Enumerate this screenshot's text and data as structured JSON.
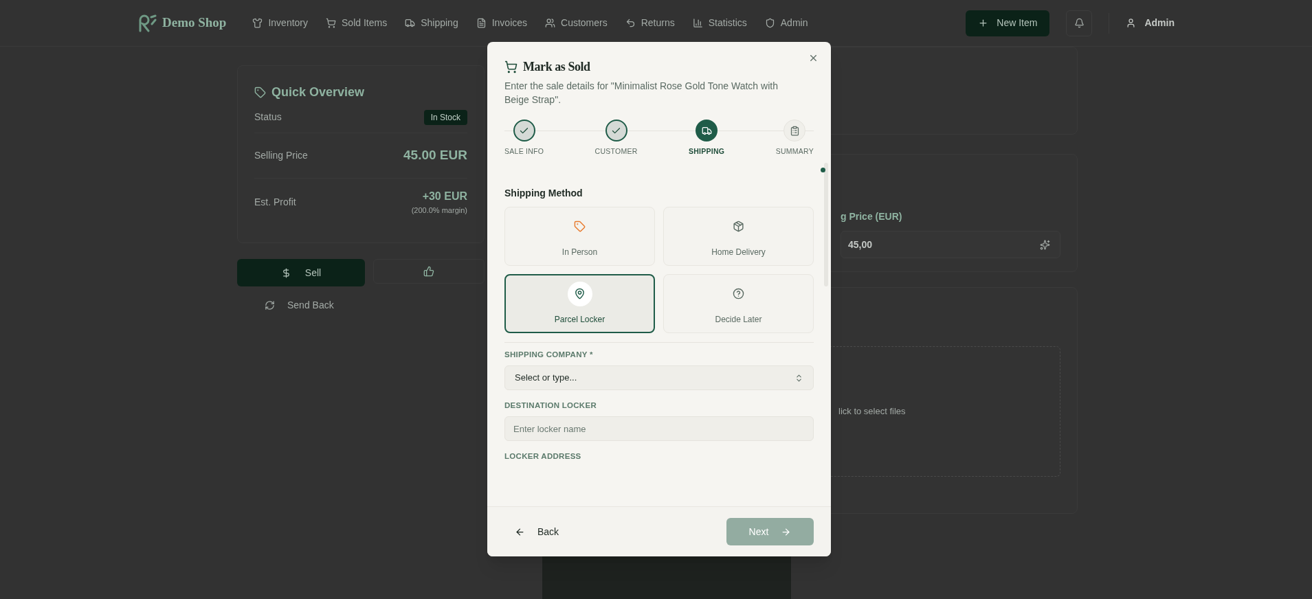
{
  "nav": {
    "brand": "Demo Shop",
    "items": [
      {
        "label": "Inventory",
        "selected": false
      },
      {
        "label": "Sold Items",
        "selected": false
      },
      {
        "label": "Shipping",
        "selected": false
      },
      {
        "label": "Invoices",
        "selected": false
      },
      {
        "label": "Customers",
        "selected": false
      },
      {
        "label": "Returns",
        "selected": false
      },
      {
        "label": "Statistics",
        "selected": false
      },
      {
        "label": "Admin",
        "selected": false
      }
    ],
    "new_item_button": "New Item",
    "user": "Admin"
  },
  "overview": {
    "title": "Quick Overview",
    "status_label": "Status",
    "status_badge": "In Stock",
    "price_label": "Selling Price",
    "price": "45.00 EUR",
    "profit_label": "Est. Profit",
    "profit": "+30 EUR",
    "margin": "(200.0% margin)"
  },
  "actions": {
    "sell": "Sell",
    "send_back": "Send Back"
  },
  "price_card": {
    "label": "g Price (EUR)",
    "value": "45,00"
  },
  "upload": {
    "text": "lick to select files"
  },
  "dialog": {
    "title": "Mark as Sold",
    "description": "Enter the sale details for \"Minimalist Rose Gold Tone Watch with Beige Strap\".",
    "steps": [
      {
        "label": "SALE INFO",
        "completed": true,
        "selected": false
      },
      {
        "label": "CUSTOMER",
        "completed": true,
        "selected": false
      },
      {
        "label": "SHIPPING",
        "completed": false,
        "selected": true
      },
      {
        "label": "SUMMARY",
        "completed": false,
        "selected": false
      }
    ],
    "section_title": "Shipping Method",
    "methods": [
      {
        "label": "In Person",
        "selected": false
      },
      {
        "label": "Home Delivery",
        "selected": false
      },
      {
        "label": "Parcel Locker",
        "selected": true
      },
      {
        "label": "Decide Later",
        "selected": false
      }
    ],
    "shipping_company": {
      "label": "SHIPPING COMPANY *",
      "placeholder": "Select or type..."
    },
    "destination_locker": {
      "label": "DESTINATION LOCKER",
      "placeholder": "Enter locker name"
    },
    "locker_address": {
      "label": "LOCKER ADDRESS"
    },
    "back": "Back",
    "next": {
      "label": "Next",
      "disabled": true
    }
  }
}
